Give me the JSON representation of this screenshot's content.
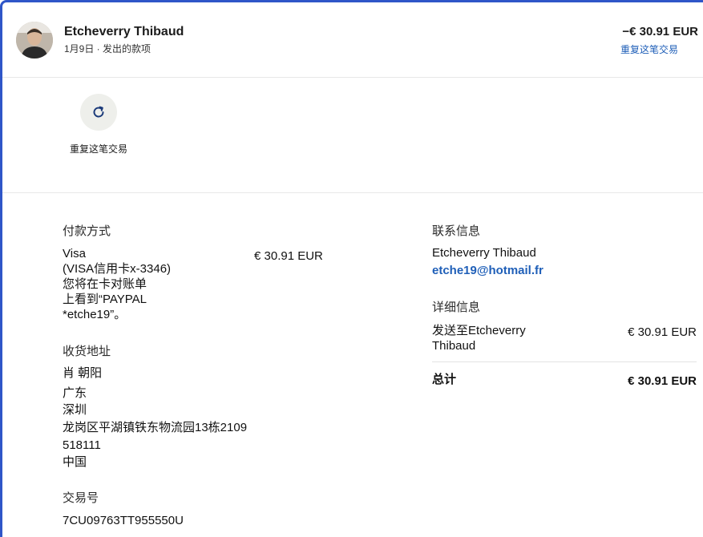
{
  "header": {
    "name": "Etcheverry Thibaud",
    "subtitle": "1月9日 · 发出的款项",
    "amount": "−€ 30.91 EUR",
    "repeat_link": "重复这笔交易"
  },
  "actions": {
    "repeat_label": "重复这笔交易",
    "repeat_icon": "refresh-icon"
  },
  "payment": {
    "title": "付款方式",
    "method_lines": [
      "Visa",
      "(VISA信用卡x-3346)",
      "您将在卡对账单",
      "上看到“PAYPAL",
      "*etche19”。"
    ],
    "amount": "€ 30.91 EUR"
  },
  "shipping": {
    "title": "收货地址",
    "name": "肖 朝阳",
    "lines": [
      "广东",
      "深圳",
      "龙岗区平湖镇铁东物流园13栋2109",
      "518111",
      "中国"
    ]
  },
  "transaction": {
    "title": "交易号",
    "id": "7CU09763TT955550U"
  },
  "contact": {
    "title": "联系信息",
    "name": "Etcheverry Thibaud",
    "email": "etche19@hotmail.fr"
  },
  "details": {
    "title": "详细信息",
    "sent_to_lines": [
      "发送至Etcheverry",
      "Thibaud"
    ],
    "sent_amount": "€ 30.91 EUR",
    "total_label": "总计",
    "total_amount": "€ 30.91 EUR"
  },
  "colors": {
    "accent": "#1f5fb8",
    "frame": "#2f56c8",
    "action_bg": "#eeefeb"
  }
}
